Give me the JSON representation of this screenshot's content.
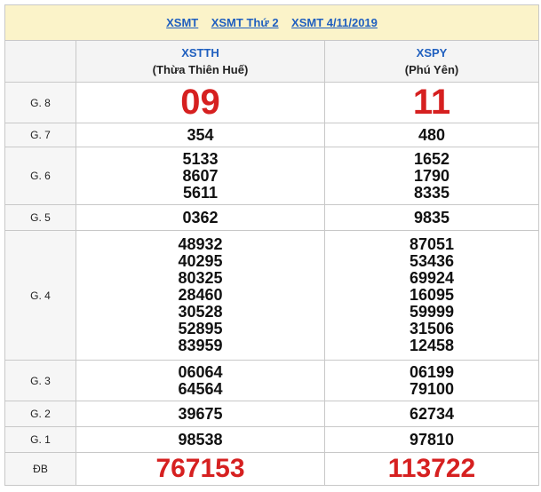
{
  "header": {
    "links": [
      "XSMT",
      "XSMT Thứ 2",
      "XSMT 4/11/2019"
    ]
  },
  "provinces": [
    {
      "code": "XSTTH",
      "name": "(Thừa Thiên Huế)"
    },
    {
      "code": "XSPY",
      "name": "(Phú Yên)"
    }
  ],
  "rows": [
    {
      "label": "G. 8",
      "cols": [
        [
          "09"
        ],
        [
          "11"
        ]
      ]
    },
    {
      "label": "G. 7",
      "cols": [
        [
          "354"
        ],
        [
          "480"
        ]
      ]
    },
    {
      "label": "G. 6",
      "cols": [
        [
          "5133",
          "8607",
          "5611"
        ],
        [
          "1652",
          "1790",
          "8335"
        ]
      ]
    },
    {
      "label": "G. 5",
      "cols": [
        [
          "0362"
        ],
        [
          "9835"
        ]
      ]
    },
    {
      "label": "G. 4",
      "cols": [
        [
          "48932",
          "40295",
          "80325",
          "28460",
          "30528",
          "52895",
          "83959"
        ],
        [
          "87051",
          "53436",
          "69924",
          "16095",
          "59999",
          "31506",
          "12458"
        ]
      ]
    },
    {
      "label": "G. 3",
      "cols": [
        [
          "06064",
          "64564"
        ],
        [
          "06199",
          "79100"
        ]
      ]
    },
    {
      "label": "G. 2",
      "cols": [
        [
          "39675"
        ],
        [
          "62734"
        ]
      ]
    },
    {
      "label": "G. 1",
      "cols": [
        [
          "98538"
        ],
        [
          "97810"
        ]
      ]
    },
    {
      "label": "ĐB",
      "cols": [
        [
          "767153"
        ],
        [
          "113722"
        ]
      ]
    }
  ],
  "colors": {
    "accent_red": "#d62020",
    "link_blue": "#1f5fbf",
    "header_bg": "#fbf3c9"
  }
}
